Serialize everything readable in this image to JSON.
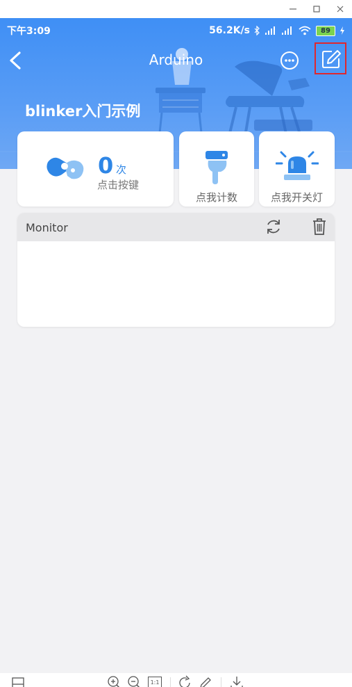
{
  "window": {
    "minimize_icon": "minimize-icon",
    "maximize_icon": "maximize-icon",
    "close_icon": "close-icon"
  },
  "status_bar": {
    "time": "下午3:09",
    "speed": "56.2K/s",
    "battery": "89",
    "icons": [
      "bluetooth-icon",
      "signal-icon",
      "hd-signal-icon",
      "wifi-icon",
      "battery-icon",
      "charging-icon"
    ]
  },
  "appbar": {
    "title": "Arduino",
    "back_icon": "back-arrow-icon",
    "more_icon": "more-icon",
    "edit_icon": "edit-icon"
  },
  "page": {
    "heading": "blinker入门示例"
  },
  "widgets": {
    "counter": {
      "value": "0",
      "unit": "次",
      "label": "点击按键"
    },
    "count_button": {
      "label": "点我计数"
    },
    "switch_button": {
      "label": "点我开关灯"
    }
  },
  "monitor": {
    "title": "Monitor",
    "refresh_icon": "refresh-icon",
    "trash_icon": "trash-icon"
  },
  "viewer_toolbar": {
    "icons": [
      "panel-icon",
      "zoom-in-icon",
      "zoom-out-icon",
      "actual-size-icon",
      "rotate-icon",
      "edit-pen-icon",
      "download-icon"
    ],
    "actual_size_text": "1:1"
  },
  "colors": {
    "header_blue": "#3f8ff5",
    "accent_blue": "#2e86e6",
    "highlight_red": "#e0272d",
    "battery_green": "#7cd34f"
  }
}
